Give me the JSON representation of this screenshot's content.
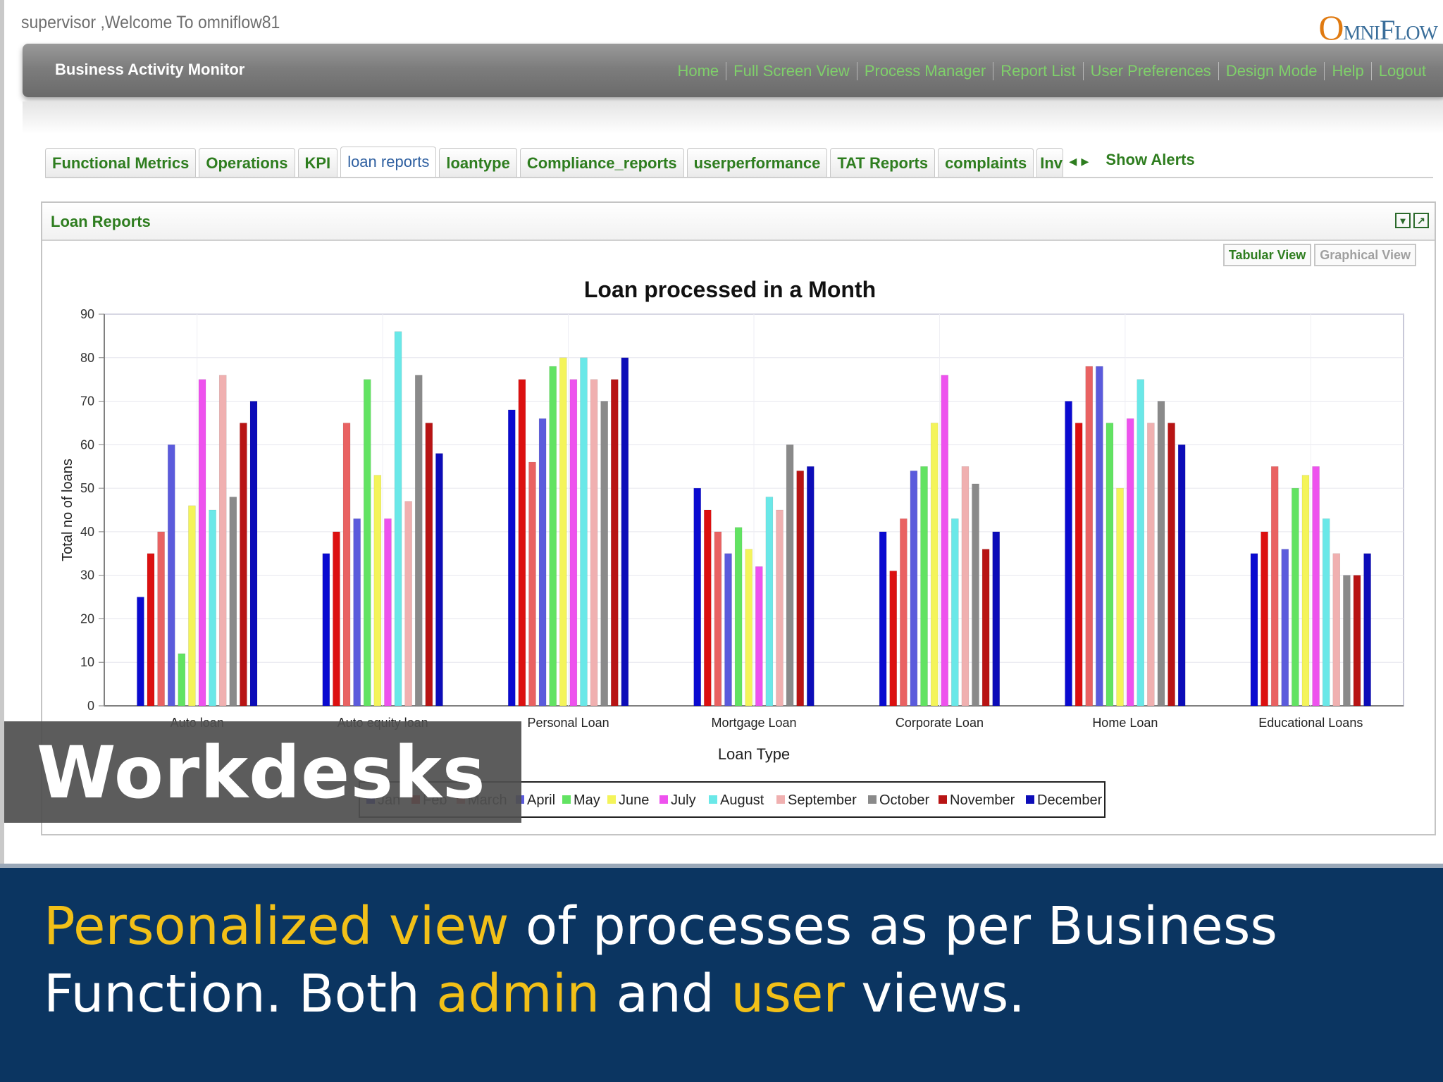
{
  "header": {
    "welcome": "supervisor ,Welcome To omniflow81",
    "logo_o": "O",
    "logo_mni": "MNI",
    "logo_f": "F",
    "logo_low": "LOW"
  },
  "titlebar": {
    "app_title": "Business Activity Monitor",
    "nav": [
      "Home",
      "Full Screen View",
      "Process Manager",
      "Report List",
      "User Preferences",
      "Design Mode",
      "Help",
      "Logout"
    ]
  },
  "tabs": {
    "items": [
      "Functional Metrics",
      "Operations",
      "KPI",
      "loan reports",
      "loantype",
      "Compliance_reports",
      "userperformance",
      "TAT Reports",
      "complaints",
      "Inv"
    ],
    "active": "loan reports",
    "arrows": "◂ ▸",
    "show_alerts": "Show Alerts"
  },
  "panel": {
    "title": "Loan Reports",
    "tabular_view": "Tabular View",
    "graphical_view": "Graphical View"
  },
  "chart_data": {
    "type": "bar",
    "title": "Loan processed in a Month",
    "xlabel": "Loan Type",
    "ylabel": "Total no of loans",
    "ylim": [
      0,
      90
    ],
    "yticks": [
      0,
      10,
      20,
      30,
      40,
      50,
      60,
      70,
      80,
      90
    ],
    "grid": true,
    "legend_position": "bottom",
    "categories": [
      "Auto loan",
      "Auto equity loan",
      "Personal Loan",
      "Mortgage Loan",
      "Corporate Loan",
      "Home Loan",
      "Educational Loans"
    ],
    "series": [
      {
        "name": "Jan",
        "color": "#0a0ad0",
        "values": [
          25,
          35,
          68,
          50,
          40,
          70,
          35
        ]
      },
      {
        "name": "Feb",
        "color": "#dc1010",
        "values": [
          35,
          40,
          75,
          45,
          31,
          65,
          40
        ]
      },
      {
        "name": "March",
        "color": "#e96262",
        "values": [
          40,
          65,
          56,
          40,
          43,
          78,
          55
        ]
      },
      {
        "name": "April",
        "color": "#5b5bdc",
        "values": [
          60,
          43,
          66,
          35,
          54,
          78,
          36
        ]
      },
      {
        "name": "May",
        "color": "#62e362",
        "values": [
          12,
          75,
          78,
          41,
          55,
          65,
          50
        ]
      },
      {
        "name": "June",
        "color": "#f4f45a",
        "values": [
          46,
          53,
          80,
          36,
          65,
          50,
          53
        ]
      },
      {
        "name": "July",
        "color": "#ee52ee",
        "values": [
          75,
          43,
          75,
          32,
          76,
          66,
          55
        ]
      },
      {
        "name": "August",
        "color": "#6ae8e8",
        "values": [
          45,
          86,
          80,
          48,
          43,
          75,
          43
        ]
      },
      {
        "name": "September",
        "color": "#f0b0b0",
        "values": [
          76,
          47,
          75,
          45,
          55,
          65,
          35
        ]
      },
      {
        "name": "October",
        "color": "#8a8a8a",
        "values": [
          48,
          76,
          70,
          60,
          51,
          70,
          30
        ]
      },
      {
        "name": "November",
        "color": "#b81414",
        "values": [
          65,
          65,
          75,
          54,
          36,
          65,
          30
        ]
      },
      {
        "name": "December",
        "color": "#0c0cb8",
        "values": [
          70,
          58,
          80,
          55,
          40,
          60,
          35
        ]
      }
    ]
  },
  "overlay": {
    "text": "Workdesks"
  },
  "caption": {
    "line1_hl": "Personalized view",
    "line1_rest": " of processes as per Business",
    "line2_a": "Function. Both ",
    "line2_hl1": "admin",
    "line2_b": " and ",
    "line2_hl2": "user",
    "line2_c": " views."
  }
}
